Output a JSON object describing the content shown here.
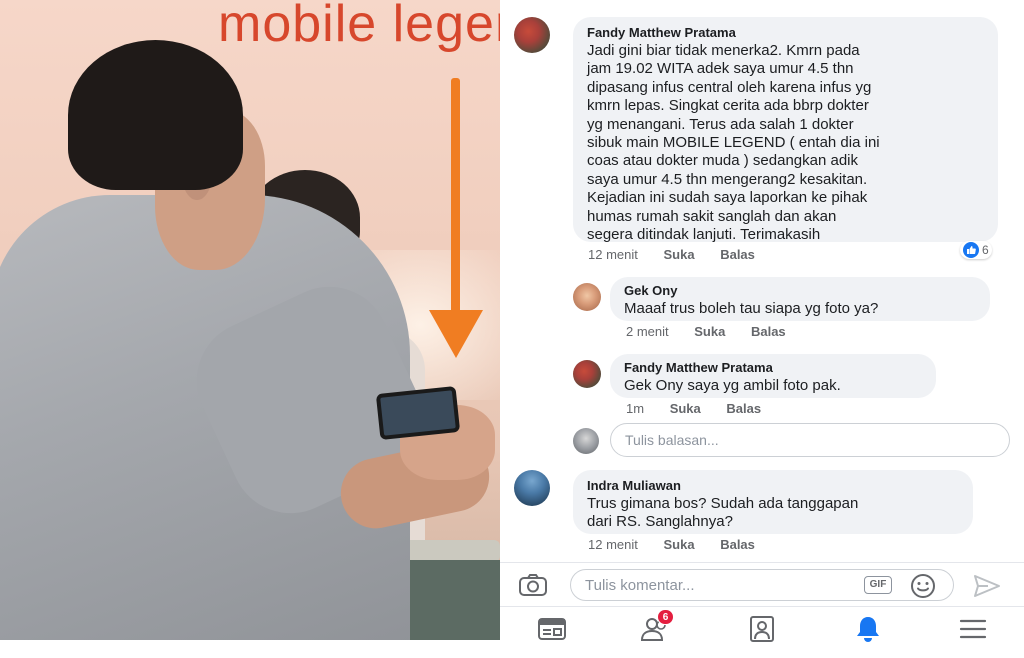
{
  "photo": {
    "banner_text": "mobile legen",
    "colors": {
      "banner": "#d7472c",
      "arrow": "#f07d22"
    }
  },
  "comments": [
    {
      "author": "Fandy Matthew Pratama",
      "text": "Jadi gini biar tidak menerka2. Kmrn pada\njam 19.02 WITA adek saya umur 4.5 thn\ndipasang infus central oleh karena infus yg\nkmrn lepas. Singkat cerita ada bbrp dokter\nyg menangani. Terus ada salah 1 dokter\nsibuk main MOBILE LEGEND ( entah dia ini\ncoas atau dokter muda ) sedangkan adik\nsaya umur 4.5 thn mengerang2 kesakitan.\nKejadian ini sudah saya laporkan ke pihak\nhumas rumah sakit sanglah dan akan\nsegera ditindak lanjuti. Terimakasih",
      "time": "12 menit",
      "like_label": "Suka",
      "reply_label": "Balas",
      "like_count": "6",
      "replies": [
        {
          "author": "Gek Ony",
          "text": "Maaaf trus boleh tau siapa yg foto ya?",
          "time": "2 menit",
          "like_label": "Suka",
          "reply_label": "Balas"
        },
        {
          "author": "Fandy Matthew Pratama",
          "text": "Gek Ony saya yg ambil foto pak.",
          "time": "1m",
          "like_label": "Suka",
          "reply_label": "Balas"
        }
      ],
      "reply_placeholder": "Tulis balasan..."
    },
    {
      "author": "Indra Muliawan",
      "text": "Trus gimana bos? Sudah ada tanggapan\ndari RS. Sanglahnya?",
      "time": "12 menit",
      "like_label": "Suka",
      "reply_label": "Balas"
    }
  ],
  "composer": {
    "placeholder": "Tulis komentar...",
    "gif_label": "GIF"
  },
  "tabbar": {
    "friend_requests_badge": "6",
    "icons": [
      "news-feed-icon",
      "friends-icon",
      "profile-icon",
      "notifications-icon",
      "menu-icon"
    ],
    "active_tab": "notifications"
  },
  "colors": {
    "bubble": "#f0f2f5",
    "meta": "#65676b",
    "accent": "#1877f2",
    "badge": "#e41e3f"
  }
}
